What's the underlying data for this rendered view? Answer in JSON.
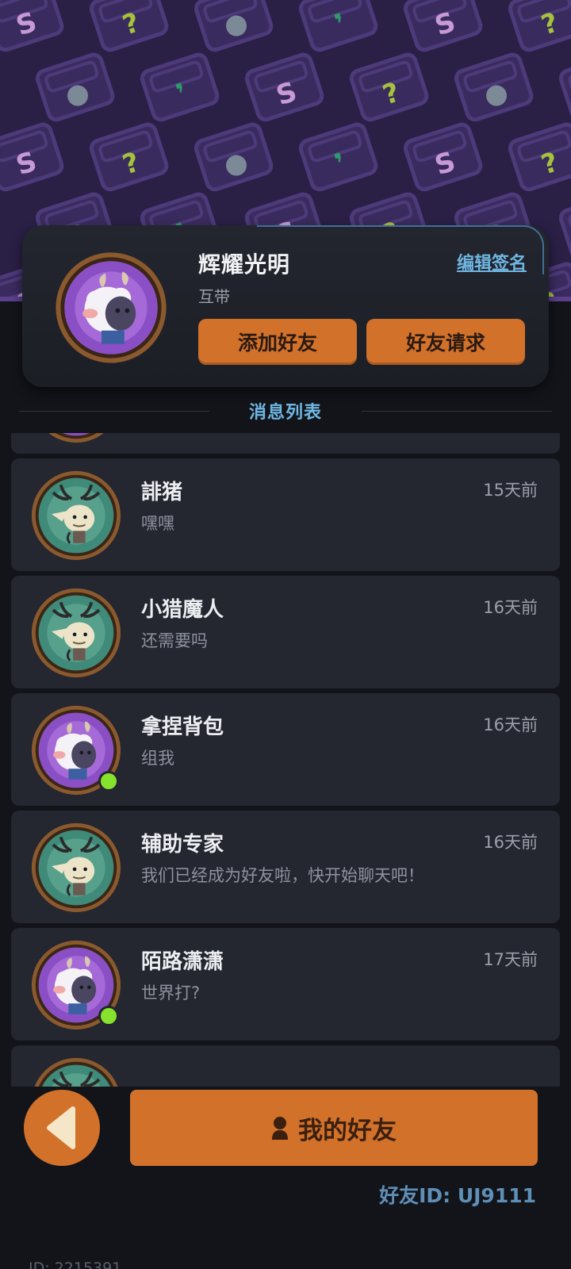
{
  "profile": {
    "username": "辉耀光明",
    "tag": "互带",
    "edit_signature": "编辑签名",
    "add_friend": "添加好友",
    "friend_request": "好友请求"
  },
  "section": {
    "title": "消息列表"
  },
  "messages": [
    {
      "name": "誹猪",
      "text": "嘿嘿",
      "time": "15天前",
      "avatar": "deer-avatar",
      "online": false
    },
    {
      "name": "小猎魔人",
      "text": "还需要吗",
      "time": "16天前",
      "avatar": "deer-avatar",
      "online": false
    },
    {
      "name": "拿捏背包",
      "text": "组我",
      "time": "16天前",
      "avatar": "sheep-avatar",
      "online": true
    },
    {
      "name": "辅助专家",
      "text": "我们已经成为好友啦，快开始聊天吧！",
      "time": "16天前",
      "avatar": "deer-avatar",
      "online": false
    },
    {
      "name": "陌路潇潇",
      "text": "世界打?",
      "time": "17天前",
      "avatar": "sheep-avatar",
      "online": true
    }
  ],
  "bottom": {
    "my_friends": "我的好友",
    "friend_id": "好友ID: UJ9111",
    "user_id": "ID: 2215391"
  },
  "colors": {
    "accent_orange": "#d2712a",
    "accent_blue": "#6fb7e3",
    "online_green": "#86e22c",
    "banner_purple": "#2a1f45"
  }
}
